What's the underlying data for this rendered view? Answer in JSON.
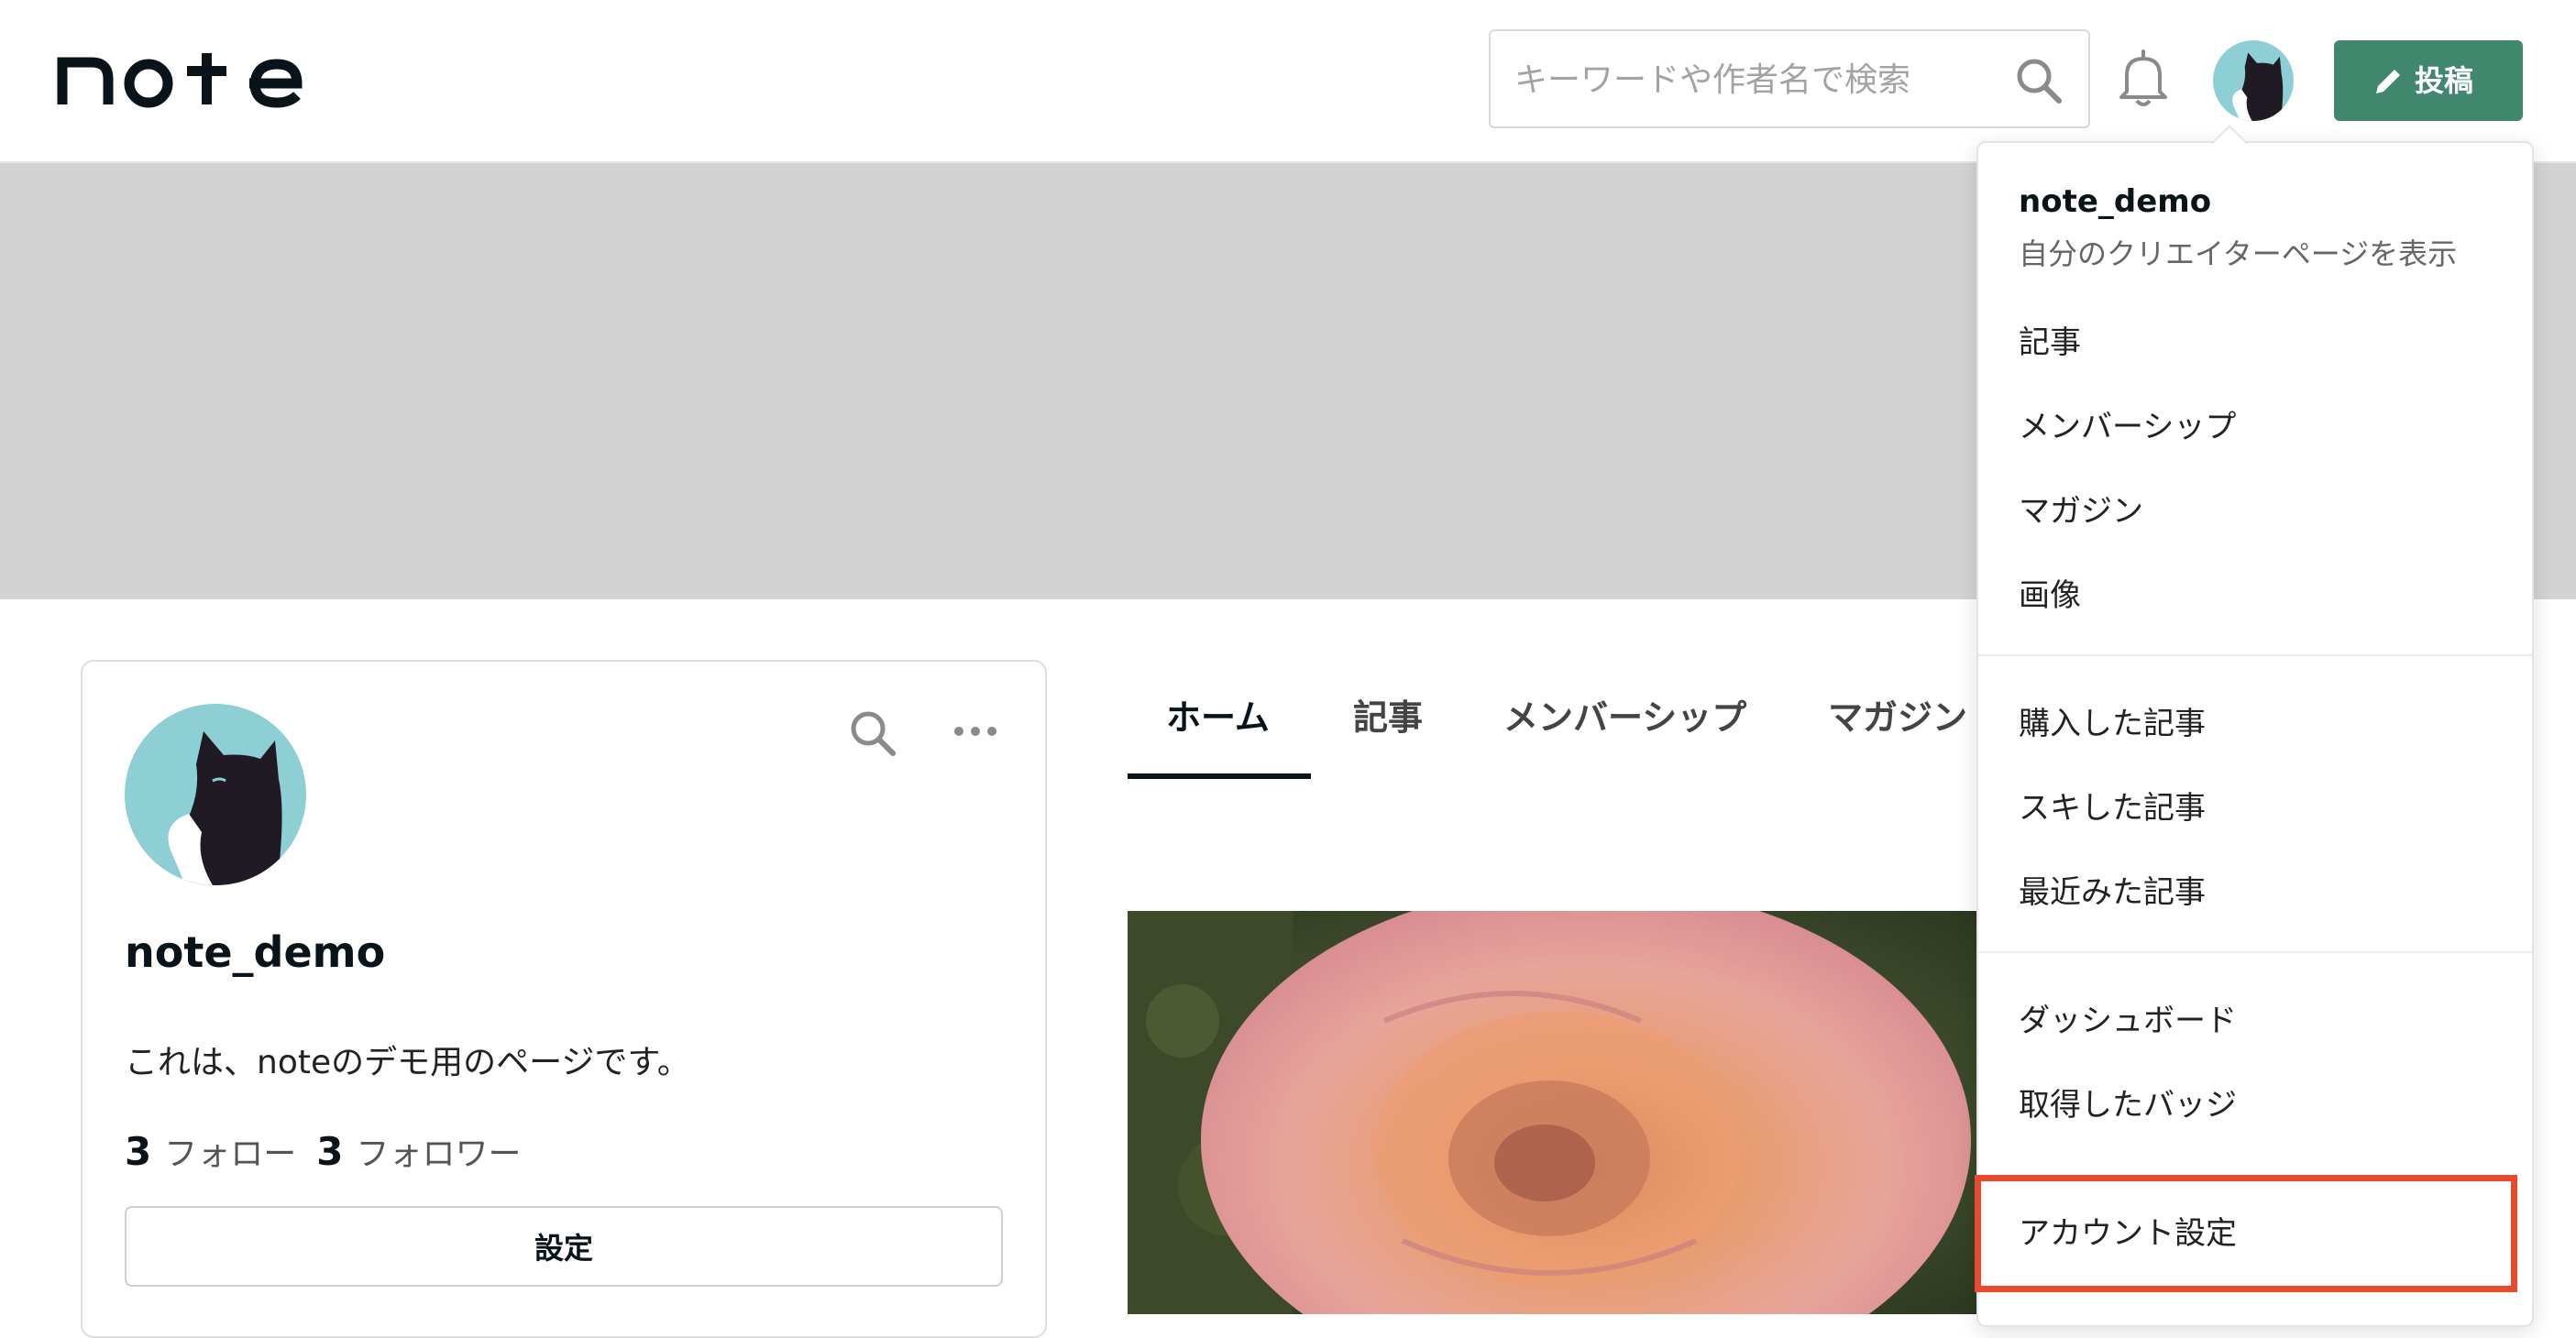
{
  "header": {
    "logo": "note",
    "search_placeholder": "キーワードや作者名で検索",
    "post_button": "投稿"
  },
  "profile": {
    "name": "note_demo",
    "bio": "これは、noteのデモ用のページです。",
    "following_count": "3",
    "following_label": "フォロー",
    "followers_count": "3",
    "followers_label": "フォロワー",
    "settings_button": "設定"
  },
  "tabs": [
    {
      "label": "ホーム",
      "active": true
    },
    {
      "label": "記事"
    },
    {
      "label": "メンバーシップ"
    },
    {
      "label": "マガジン"
    }
  ],
  "menu": {
    "user_name": "note_demo",
    "user_sub": "自分のクリエイターページを表示",
    "items": [
      {
        "label": "記事"
      },
      {
        "label": "メンバーシップ"
      },
      {
        "label": "マガジン"
      },
      {
        "label": "画像"
      },
      {
        "label": "購入した記事"
      },
      {
        "label": "スキした記事"
      },
      {
        "label": "最近みた記事"
      },
      {
        "label": "ダッシュボード"
      },
      {
        "label": "取得したバッジ"
      },
      {
        "label": "アカウント設定",
        "highlighted": true
      }
    ]
  },
  "colors": {
    "accent_green": "#41876e",
    "highlight_red": "#e94a2e",
    "avatar_bg": "#8ecfd6"
  },
  "icons": [
    "search-icon",
    "bell-icon",
    "pencil-icon",
    "more-icon"
  ]
}
